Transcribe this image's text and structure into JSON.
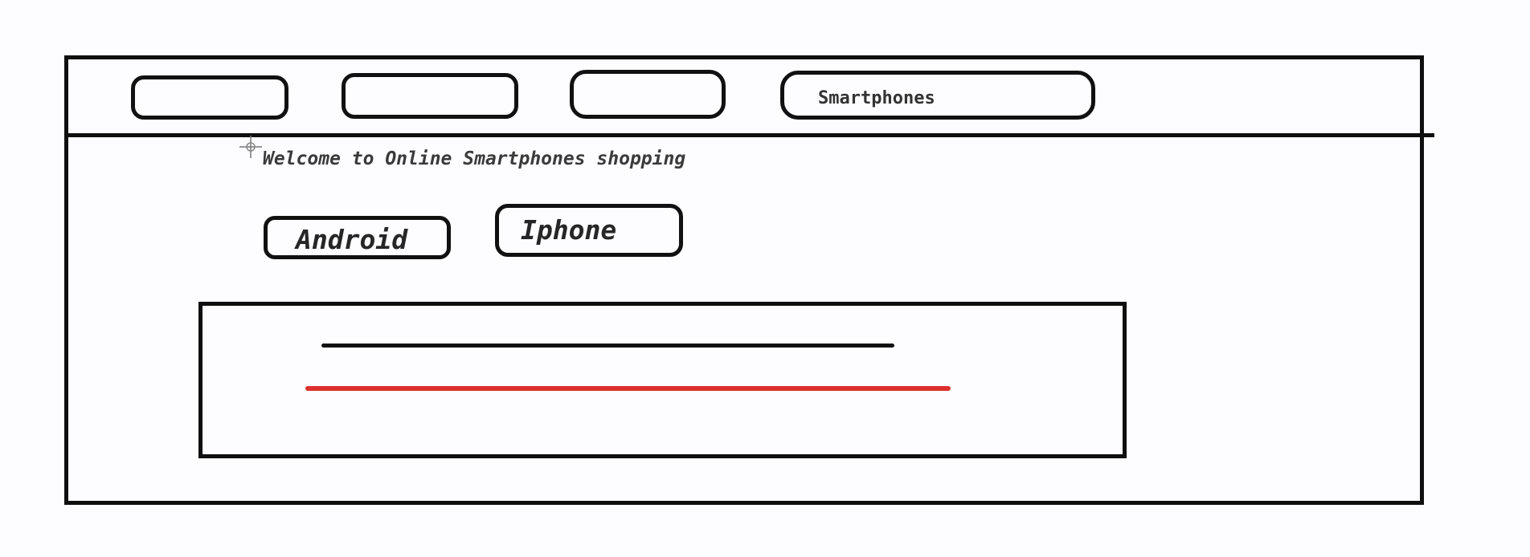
{
  "nav": {
    "items": [
      {
        "label": ""
      },
      {
        "label": ""
      },
      {
        "label": ""
      },
      {
        "label": "Smartphones"
      }
    ]
  },
  "main": {
    "welcome_text": "Welcome to Online Smartphones shopping",
    "categories": [
      {
        "label": "Android"
      },
      {
        "label": "Iphone"
      }
    ]
  },
  "colors": {
    "stroke": "#0f0f0f",
    "accent_line": "#dc3030",
    "background": "#fdfcfe"
  }
}
